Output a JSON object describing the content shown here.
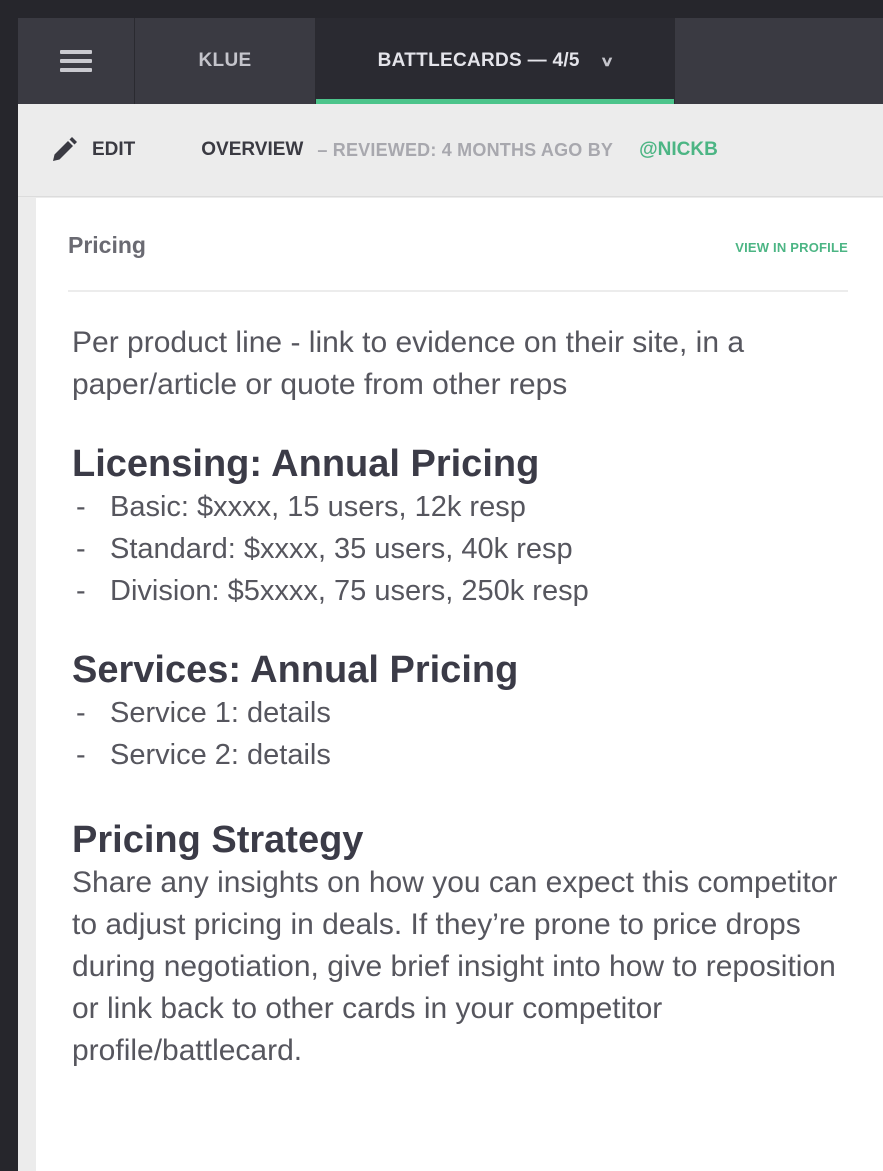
{
  "nav": {
    "menu_icon": "hamburger-menu-icon",
    "tabs": [
      {
        "label": "KLUE"
      },
      {
        "label": "BATTLECARDS — 4/5",
        "dropdown_icon": "chevron-down-icon",
        "active": true
      }
    ],
    "active_underline_color": "#4cc48b"
  },
  "subbar": {
    "edit_icon": "pencil-icon",
    "edit_label": "EDIT",
    "overview_label": "OVERVIEW",
    "reviewed_text": "– REVIEWED: 4 MONTHS AGO BY",
    "reviewer": "@NICKB",
    "accent_color": "#4cb584"
  },
  "card": {
    "title": "Pricing",
    "view_in_profile": "VIEW IN PROFILE",
    "intro": "Per product line - link to evidence on their site, in a paper/article or quote from other reps",
    "sections": [
      {
        "heading": "Licensing: Annual Pricing",
        "items": [
          "Basic: $xxxx, 15 users, 12k resp",
          "Standard: $xxxx, 35 users, 40k resp",
          "Division: $5xxxx, 75 users, 250k resp"
        ]
      },
      {
        "heading": "Services: Annual Pricing",
        "items": [
          "Service 1: details",
          "Service 2: details"
        ]
      },
      {
        "heading": "Pricing Strategy",
        "text": "Share any insights on how you can expect this competitor to adjust pricing in deals. If they’re prone to price drops during negotiation,  give brief insight into how to reposition or link back to other cards in your competitor profile/battlecard."
      }
    ]
  }
}
